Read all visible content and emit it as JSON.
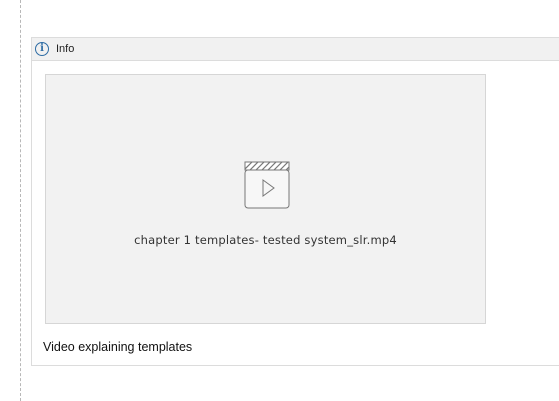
{
  "panel": {
    "title": "Info",
    "icon": "info-icon"
  },
  "video": {
    "icon": "video-clapperboard-icon",
    "file_name": "chapter 1 templates- tested system_slr.mp4",
    "caption": "Video explaining templates"
  },
  "colors": {
    "accent": "#2e6ca4",
    "header_bg": "#f1f1f1",
    "placeholder_bg": "#f2f2f2"
  }
}
